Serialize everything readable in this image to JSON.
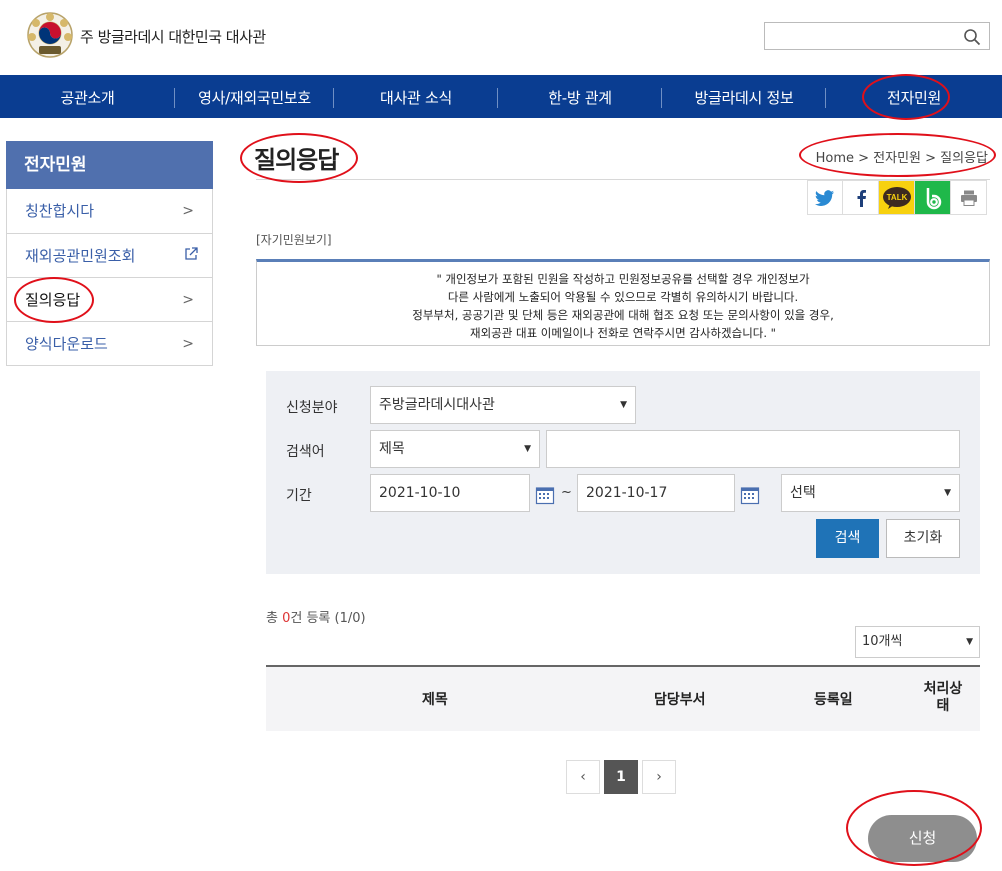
{
  "header": {
    "site_title": "주 방글라데시 대한민국 대사관",
    "search_placeholder": ""
  },
  "gnb": {
    "items": [
      {
        "label": "공관소개"
      },
      {
        "label": "영사/재외국민보호"
      },
      {
        "label": "대사관 소식"
      },
      {
        "label": "한-방 관계"
      },
      {
        "label": "방글라데시 정보"
      },
      {
        "label": "전자민원"
      }
    ]
  },
  "lnb": {
    "title": "전자민원",
    "items": [
      {
        "label": "칭찬합시다"
      },
      {
        "label": "재외공관민원조회"
      },
      {
        "label": "질의응답"
      },
      {
        "label": "양식다운로드"
      }
    ]
  },
  "page": {
    "title": "질의응답",
    "breadcrumb": "Home > 전자민원 > 질의응답",
    "subinfo": "[자기민원보기]",
    "notice": [
      "\" 개인정보가 포함된 민원을 작성하고 민원정보공유를 선택할 경우 개인정보가",
      "다른 사람에게 노출되어 악용될 수 있으므로 각별히 유의하시기 바랍니다.",
      "정부부처, 공공기관 및 단체 등은 재외공관에 대해 협조 요청 또는 문의사항이 있을 경우,",
      "재외공관 대표 이메일이나 전화로 연락주시면 감사하겠습니다. \""
    ]
  },
  "search": {
    "field_label": "신청분야",
    "field_value": "주방글라데시대사관",
    "keyword_label": "검색어",
    "keyword_type": "제목",
    "keyword_value": "",
    "period_label": "기간",
    "date_from": "2021-10-10",
    "date_sep": "~",
    "date_to": "2021-10-17",
    "period_select": "선택",
    "search_button": "검색",
    "reset_button": "초기화"
  },
  "list": {
    "count_prefix": "총 ",
    "count": "0",
    "count_suffix": "건 등록 (1/0)",
    "per_page": "10개씩",
    "columns": [
      "제목",
      "담당부서",
      "등록일",
      "처리상\n태"
    ]
  },
  "pagination": {
    "prev": "‹",
    "current": "1",
    "next": "›"
  },
  "apply_button": "신청",
  "colors": {
    "nav_blue": "#0a3d91",
    "lnb_title": "#5070ae",
    "search_button": "#1f73b7",
    "annotation_red": "#e0101a"
  }
}
